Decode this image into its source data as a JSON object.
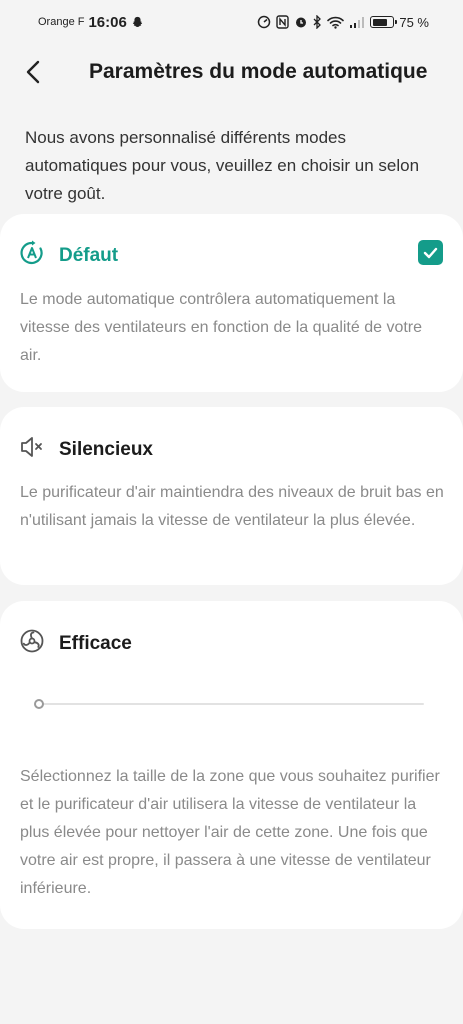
{
  "status_bar": {
    "carrier": "Orange F",
    "time": "16:06",
    "battery_percent": "75 %",
    "battery_level": 0.75
  },
  "header": {
    "back_icon": "chevron-left-icon",
    "title": "Paramètres du mode automatique"
  },
  "intro_text": "Nous avons personnalisé différents modes automatiques pour vous, veuillez en choisir un selon votre goût.",
  "colors": {
    "accent": "#149c8a",
    "card_bg": "#ffffff",
    "page_bg": "#f4f4f4"
  },
  "modes": [
    {
      "icon": "auto-mode-icon",
      "title": "Défaut",
      "description": "Le mode automatique contrôlera automatiquement la vitesse des ventilateurs en fonction de la qualité de votre air.",
      "selected": true
    },
    {
      "icon": "speaker-mute-icon",
      "title": "Silencieux",
      "description": "Le purificateur d'air maintiendra des niveaux de bruit bas en n'utilisant jamais la vitesse de ventilateur la plus élevée.",
      "selected": false
    },
    {
      "icon": "fan-icon",
      "title": "Efficace",
      "description": "Sélectionnez la taille de la zone que vous souhaitez purifier et le purificateur d'air utilisera la vitesse de ventilateur la plus élevée pour nettoyer l'air de cette zone. Une fois que votre air est propre, il passera à une vitesse de ventilateur inférieure.",
      "selected": false,
      "slider_value": 0
    }
  ]
}
